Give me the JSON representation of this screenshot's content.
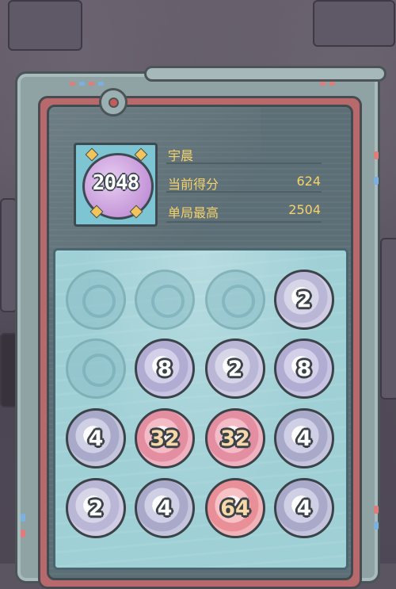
{
  "player": {
    "name": "宇晨",
    "current_score_label": "当前得分",
    "current_score": "624",
    "best_score_label": "单局最高",
    "best_score": "2504"
  },
  "avatar": {
    "logo_text": "2048",
    "icon": "shell-2048-logo"
  },
  "board": {
    "rows": [
      [
        "",
        "",
        "",
        "2"
      ],
      [
        "",
        "8",
        "2",
        "8"
      ],
      [
        "4",
        "32",
        "32",
        "4"
      ],
      [
        "2",
        "4",
        "64",
        "4"
      ]
    ]
  },
  "colors": {
    "score_text": "#f6d36a",
    "board_bg": "#9fd0d6",
    "frame": "#8fa3a5",
    "frame_accent": "#b8696c"
  }
}
